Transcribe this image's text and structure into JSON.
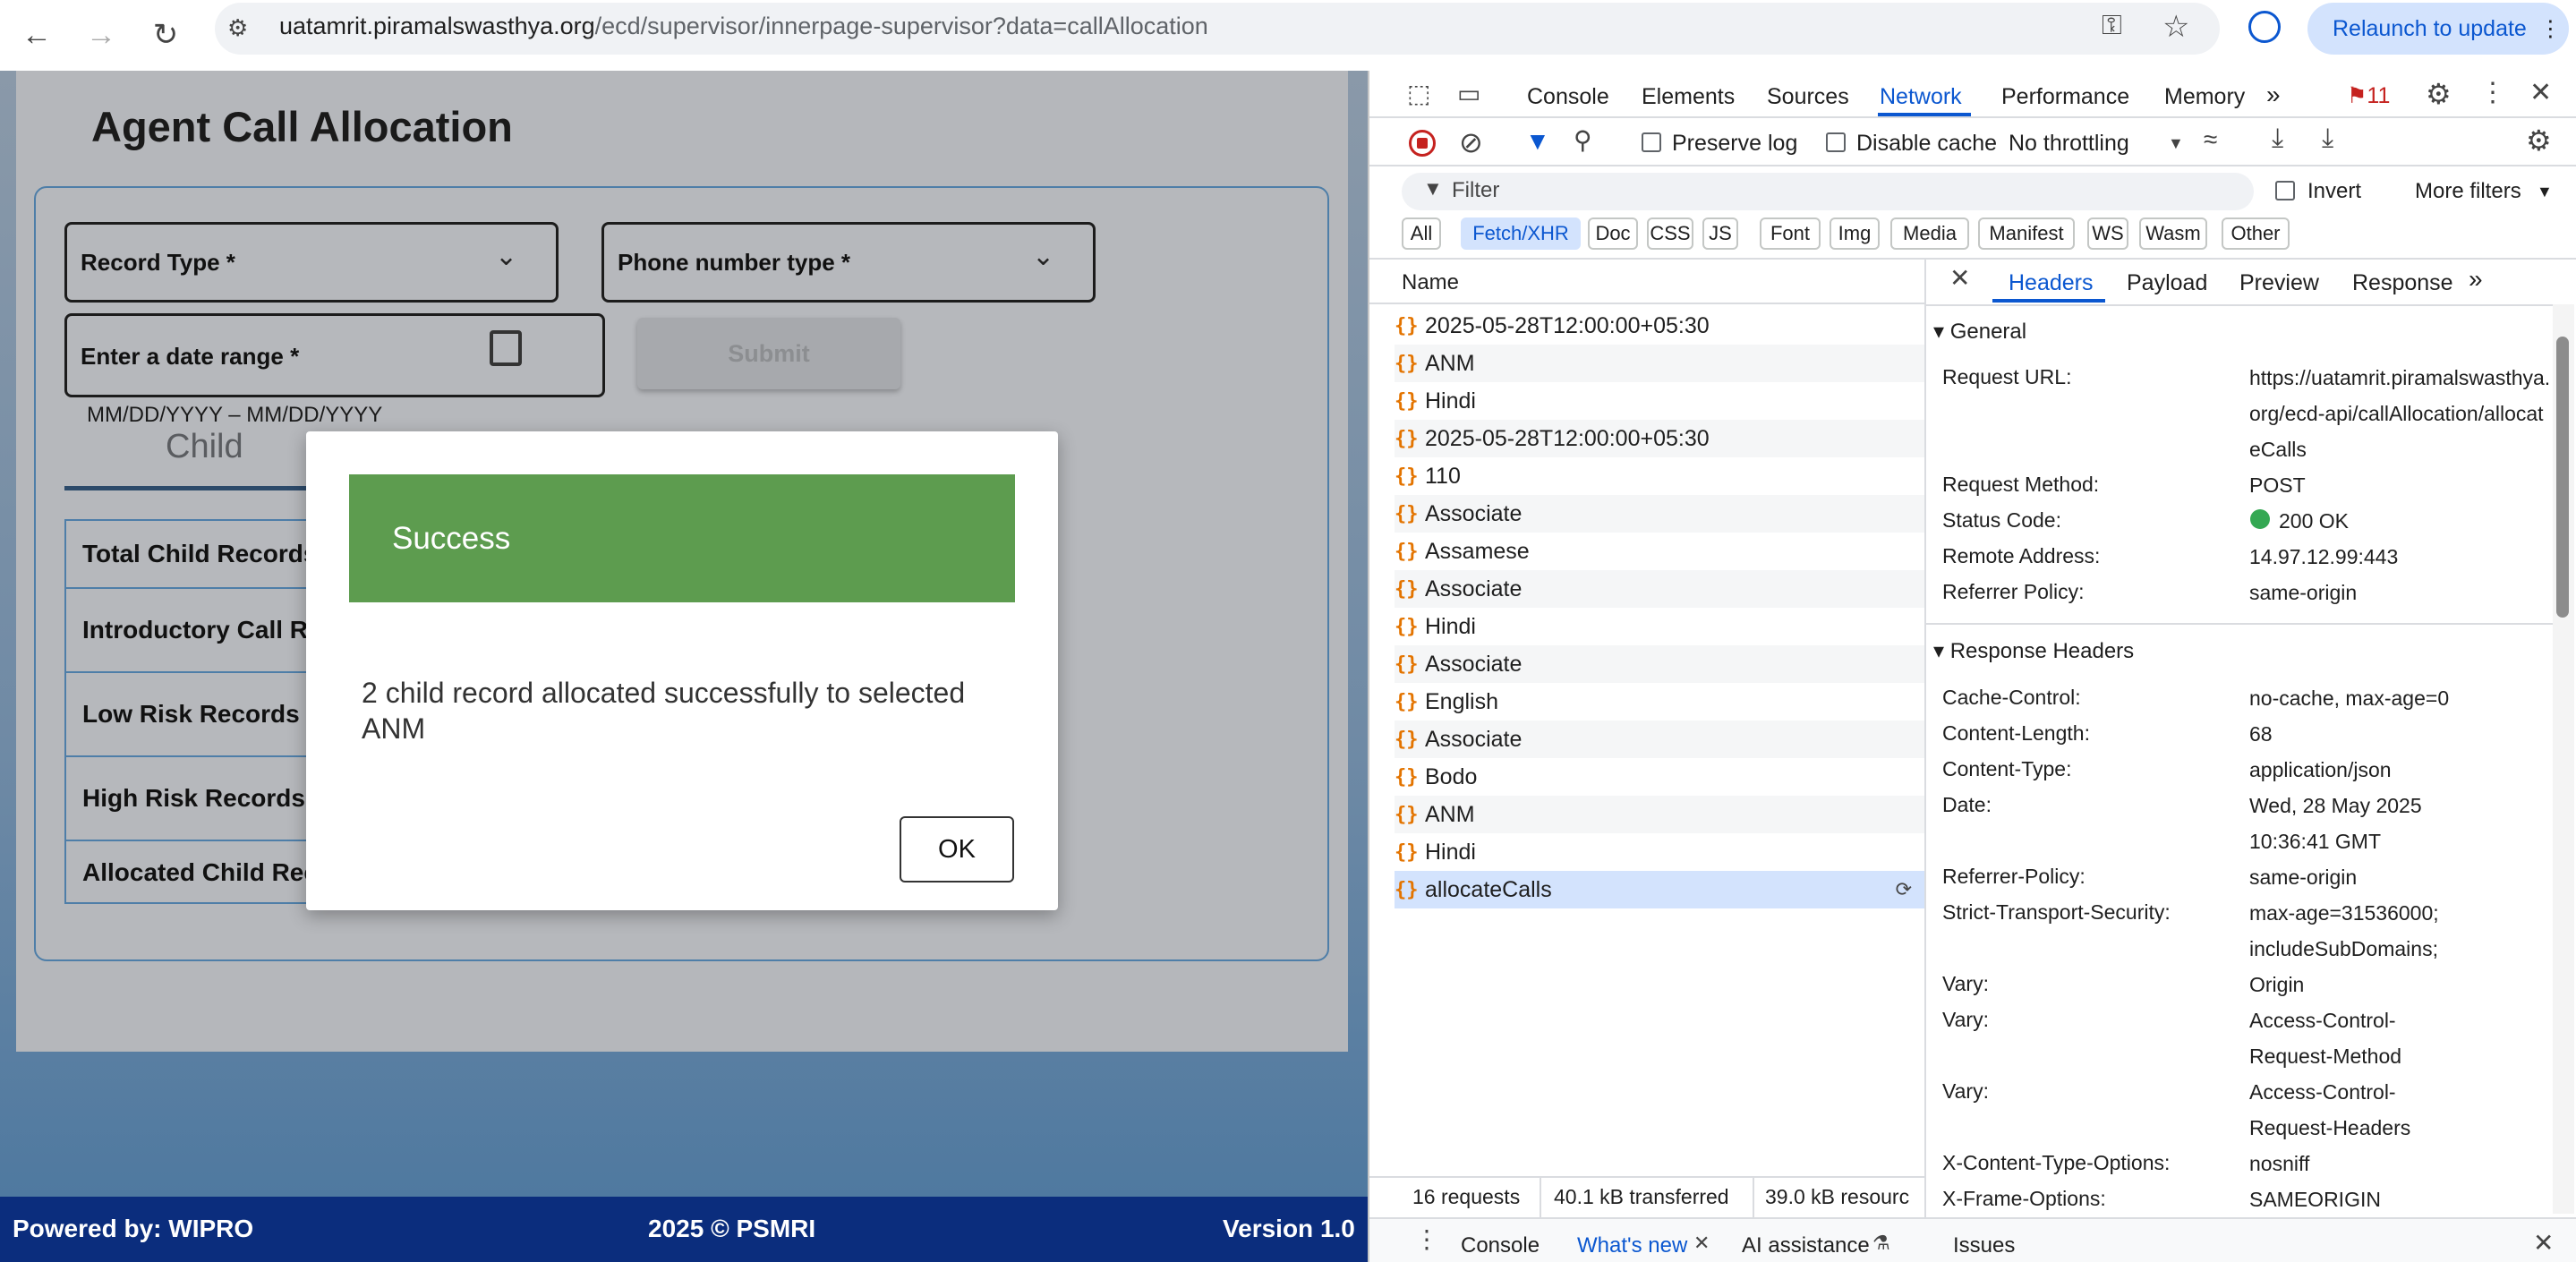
{
  "browser": {
    "url_host": "uatamrit.piramalswasthya.org",
    "url_path": "/ecd/supervisor/innerpage-supervisor?data=callAllocation",
    "relaunch_label": "Relaunch to update"
  },
  "page": {
    "title": "Agent Call Allocation",
    "record_type_label": "Record Type *",
    "phone_type_label": "Phone number type *",
    "date_range_label": "Enter a date range *",
    "date_hint": "MM/DD/YYYY – MM/DD/YYYY",
    "submit_label": "Submit",
    "child_tab": "Child",
    "records": [
      "Total Child Records",
      "Introductory Call Records",
      "Low Risk Records",
      "High Risk Records",
      "Allocated Child Records"
    ]
  },
  "dialog": {
    "title": "Success",
    "message": "2 child record allocated successfully to selected ANM",
    "ok_label": "OK"
  },
  "footer": {
    "powered": "Powered by: WIPRO",
    "copyright": "2025 © PSMRI",
    "version": "Version 1.0"
  },
  "devtools": {
    "tabs": [
      "Console",
      "Elements",
      "Sources",
      "Network",
      "Performance",
      "Memory"
    ],
    "active_tab": "Network",
    "issues_count": "11",
    "preserve_log": "Preserve log",
    "disable_cache": "Disable cache",
    "throttling": "No throttling",
    "filter_placeholder": "Filter",
    "invert": "Invert",
    "more_filters": "More filters",
    "filter_chips": [
      "All",
      "Fetch/XHR",
      "Doc",
      "CSS",
      "JS",
      "Font",
      "Img",
      "Media",
      "Manifest",
      "WS",
      "Wasm",
      "Other"
    ],
    "name_header": "Name",
    "requests": [
      "2025-05-28T12:00:00+05:30",
      "ANM",
      "Hindi",
      "2025-05-28T12:00:00+05:30",
      "110",
      "Associate",
      "Assamese",
      "Associate",
      "Hindi",
      "Associate",
      "English",
      "Associate",
      "Bodo",
      "ANM",
      "Hindi",
      "allocateCalls"
    ],
    "status_bar": {
      "requests": "16 requests",
      "transferred": "40.1 kB transferred",
      "resources": "39.0 kB resourc"
    },
    "detail_tabs": [
      "Headers",
      "Payload",
      "Preview",
      "Response"
    ],
    "general_title": "General",
    "general": [
      {
        "k": "Request URL:",
        "v": "https://uatamrit.piramalswasthya.org/ecd-api/callAllocation/allocateCalls"
      },
      {
        "k": "Request Method:",
        "v": "POST"
      },
      {
        "k": "Status Code:",
        "v": "200 OK"
      },
      {
        "k": "Remote Address:",
        "v": "14.97.12.99:443"
      },
      {
        "k": "Referrer Policy:",
        "v": "same-origin"
      }
    ],
    "response_title": "Response Headers",
    "response_headers": [
      {
        "k": "Cache-Control:",
        "v": "no-cache, max-age=0"
      },
      {
        "k": "Content-Length:",
        "v": "68"
      },
      {
        "k": "Content-Type:",
        "v": "application/json"
      },
      {
        "k": "Date:",
        "v": "Wed, 28 May 2025 10:36:41 GMT"
      },
      {
        "k": "Referrer-Policy:",
        "v": "same-origin"
      },
      {
        "k": "Strict-Transport-Security:",
        "v": "max-age=31536000; includeSubDomains;"
      },
      {
        "k": "Vary:",
        "v": "Origin"
      },
      {
        "k": "Vary:",
        "v": "Access-Control-Request-Method"
      },
      {
        "k": "Vary:",
        "v": "Access-Control-Request-Headers"
      },
      {
        "k": "X-Content-Type-Options:",
        "v": "nosniff"
      },
      {
        "k": "X-Frame-Options:",
        "v": "SAMEORIGIN"
      }
    ],
    "drawer_tabs": [
      "Console",
      "What's new",
      "AI assistance",
      "Issues"
    ],
    "status_color": "#34a853"
  }
}
